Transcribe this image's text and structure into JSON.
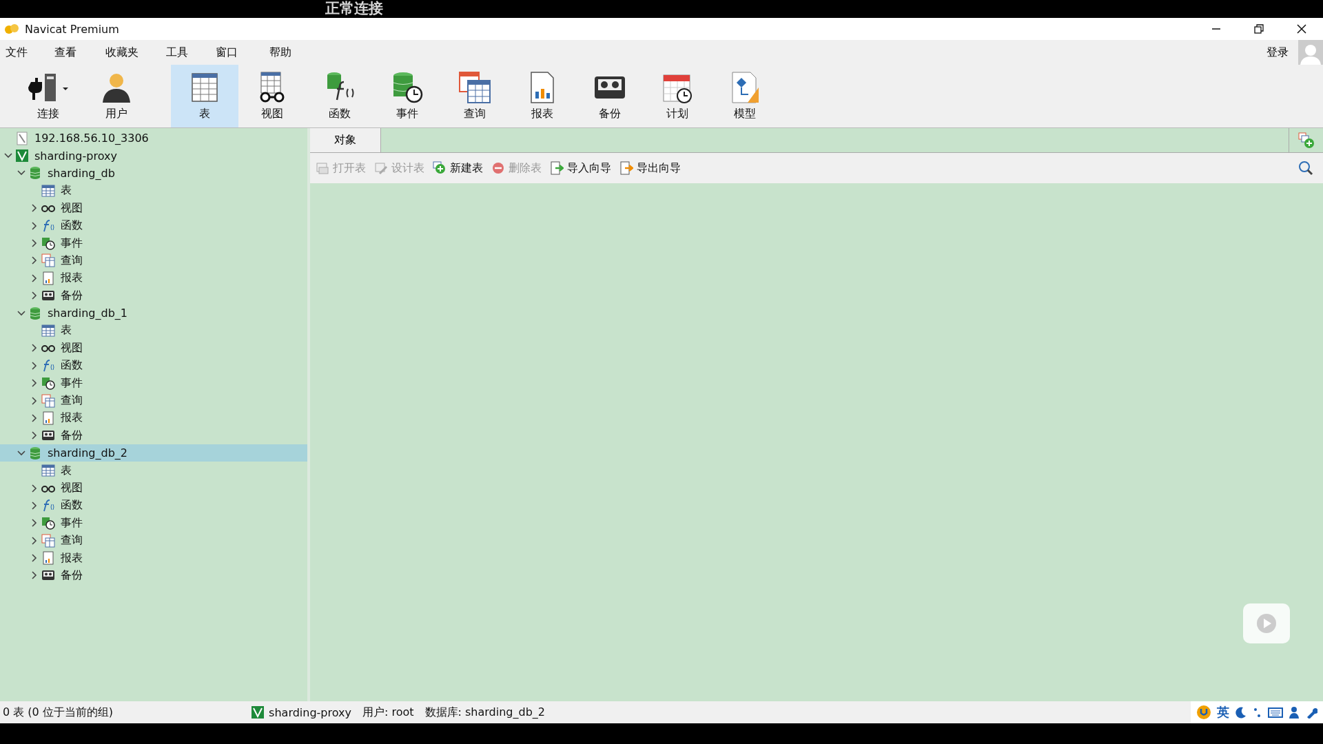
{
  "caption": "正常连接",
  "window": {
    "title": "Navicat Premium"
  },
  "menu": [
    "文件",
    "查看",
    "收藏夹",
    "工具",
    "窗口",
    "帮助"
  ],
  "login": "登录",
  "toolbar": [
    {
      "kind": "connection",
      "label": "连接",
      "selected": false
    },
    {
      "kind": "user",
      "label": "用户",
      "selected": false
    },
    {
      "kind": "table",
      "label": "表",
      "selected": true
    },
    {
      "kind": "view",
      "label": "视图",
      "selected": false
    },
    {
      "kind": "function",
      "label": "函数",
      "selected": false
    },
    {
      "kind": "event",
      "label": "事件",
      "selected": false
    },
    {
      "kind": "query",
      "label": "查询",
      "selected": false
    },
    {
      "kind": "report",
      "label": "报表",
      "selected": false
    },
    {
      "kind": "backup",
      "label": "备份",
      "selected": false
    },
    {
      "kind": "schedule",
      "label": "计划",
      "selected": false
    },
    {
      "kind": "model",
      "label": "模型",
      "selected": false
    }
  ],
  "tree": [
    {
      "kind": "server",
      "label": "192.168.56.10_3306",
      "selected": false
    },
    {
      "kind": "connection",
      "label": "sharding-proxy",
      "selected": false,
      "expanded": true,
      "children": [
        {
          "kind": "database",
          "label": "sharding_db",
          "selected": false,
          "expanded": true,
          "children": [
            {
              "kind": "table",
              "label": "表",
              "selected": false
            },
            {
              "kind": "view",
              "label": "视图",
              "selected": false,
              "expanded": false
            },
            {
              "kind": "function",
              "label": "函数",
              "selected": false,
              "expanded": false
            },
            {
              "kind": "event",
              "label": "事件",
              "selected": false,
              "expanded": false
            },
            {
              "kind": "query",
              "label": "查询",
              "selected": false,
              "expanded": false
            },
            {
              "kind": "report",
              "label": "报表",
              "selected": false,
              "expanded": false
            },
            {
              "kind": "backup",
              "label": "备份",
              "selected": false,
              "expanded": false
            }
          ]
        },
        {
          "kind": "database",
          "label": "sharding_db_1",
          "selected": false,
          "expanded": true,
          "children": [
            {
              "kind": "table",
              "label": "表",
              "selected": false
            },
            {
              "kind": "view",
              "label": "视图",
              "selected": false,
              "expanded": false
            },
            {
              "kind": "function",
              "label": "函数",
              "selected": false,
              "expanded": false
            },
            {
              "kind": "event",
              "label": "事件",
              "selected": false,
              "expanded": false
            },
            {
              "kind": "query",
              "label": "查询",
              "selected": false,
              "expanded": false
            },
            {
              "kind": "report",
              "label": "报表",
              "selected": false,
              "expanded": false
            },
            {
              "kind": "backup",
              "label": "备份",
              "selected": false,
              "expanded": false
            }
          ]
        },
        {
          "kind": "database",
          "label": "sharding_db_2",
          "selected": true,
          "expanded": true,
          "children": [
            {
              "kind": "table",
              "label": "表",
              "selected": false
            },
            {
              "kind": "view",
              "label": "视图",
              "selected": false,
              "expanded": false
            },
            {
              "kind": "function",
              "label": "函数",
              "selected": false,
              "expanded": false
            },
            {
              "kind": "event",
              "label": "事件",
              "selected": false,
              "expanded": false
            },
            {
              "kind": "query",
              "label": "查询",
              "selected": false,
              "expanded": false
            },
            {
              "kind": "report",
              "label": "报表",
              "selected": false,
              "expanded": false
            },
            {
              "kind": "backup",
              "label": "备份",
              "selected": false,
              "expanded": false
            }
          ]
        }
      ]
    }
  ],
  "tabs": [
    {
      "label": "对象",
      "selected": true
    }
  ],
  "object_toolbar": [
    {
      "kind": "open",
      "label": "打开表",
      "disabled": true
    },
    {
      "kind": "design",
      "label": "设计表",
      "disabled": true
    },
    {
      "kind": "new",
      "label": "新建表",
      "disabled": false
    },
    {
      "kind": "delete",
      "label": "删除表",
      "disabled": true
    },
    {
      "kind": "import",
      "label": "导入向导",
      "disabled": false
    },
    {
      "kind": "export",
      "label": "导出向导",
      "disabled": false
    }
  ],
  "status_bar": {
    "summary": "0 表 (0 位于当前的组)",
    "connection": "sharding-proxy",
    "user": "用户: root",
    "database": "数据库: sharding_db_2",
    "ime": "英"
  }
}
